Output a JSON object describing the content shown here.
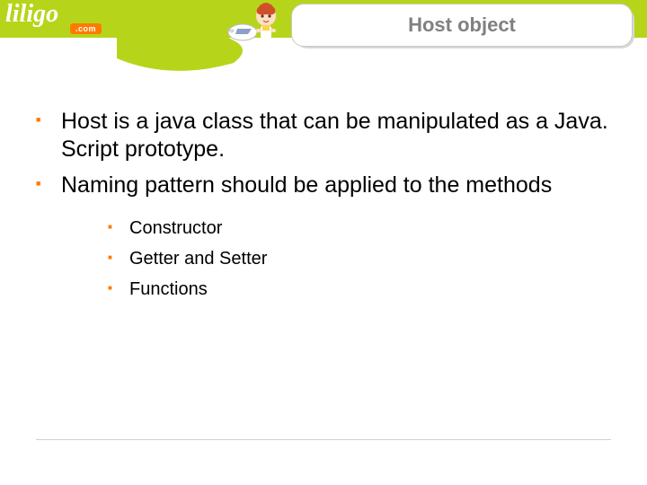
{
  "brand": {
    "name": "liligo",
    "tag": ".com",
    "accent": "#ff7a00",
    "band": "#b6d51a"
  },
  "title": "Host object",
  "bullets_level1": [
    "Host is a java class that can be manipulated as a Java. Script prototype.",
    "Naming pattern should be applied to the methods"
  ],
  "bullets_level2": [
    "Constructor",
    "Getter and Setter",
    "Functions"
  ]
}
